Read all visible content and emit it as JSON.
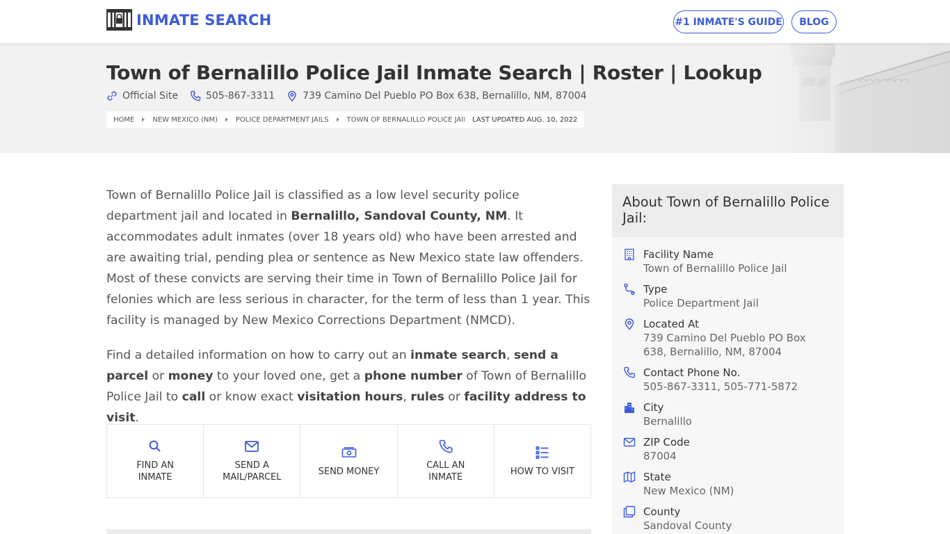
{
  "header": {
    "logo_text": "INMATE SEARCH",
    "nav": [
      {
        "label": "#1 INMATE'S GUIDE"
      },
      {
        "label": "BLOG"
      }
    ]
  },
  "hero": {
    "title": "Town of Bernalillo Police Jail Inmate Search | Roster | Lookup",
    "official_site": "Official Site",
    "phone": "505-867-3311",
    "address": "739 Camino Del Pueblo PO Box 638, Bernalillo, NM, 87004",
    "breadcrumbs": [
      "HOME",
      "NEW MEXICO (NM)",
      "POLICE DEPARTMENT JAILS",
      "TOWN OF BERNALILLO POLICE JAIL"
    ],
    "last_updated": "LAST UPDATED AUG. 10, 2022"
  },
  "content": {
    "p1_a": "Town of Bernalillo Police Jail is classified as a low level security police department jail and located in ",
    "p1_b": "Bernalillo, Sandoval County, NM",
    "p1_c": ". It accommodates adult inmates (over 18 years old) who have been arrested and are awaiting trial, pending plea or sentence as New Mexico state law offenders. Most of these convicts are serving their time in Town of Bernalillo Police Jail for felonies which are less serious in character, for the term of less than 1 year. This facility is managed by New Mexico Corrections Department (NMCD).",
    "p2": [
      {
        "t": "Find a detailed information on how to carry out an ",
        "b": false
      },
      {
        "t": "inmate search",
        "b": true
      },
      {
        "t": ", ",
        "b": false
      },
      {
        "t": "send a parcel",
        "b": true
      },
      {
        "t": " or ",
        "b": false
      },
      {
        "t": "money",
        "b": true
      },
      {
        "t": " to your loved one, get a ",
        "b": false
      },
      {
        "t": "phone number",
        "b": true
      },
      {
        "t": " of Town of Bernalillo Police Jail to ",
        "b": false
      },
      {
        "t": "call",
        "b": true
      },
      {
        "t": " or know exact ",
        "b": false
      },
      {
        "t": "visitation hours",
        "b": true
      },
      {
        "t": ", ",
        "b": false
      },
      {
        "t": "rules",
        "b": true
      },
      {
        "t": " or ",
        "b": false
      },
      {
        "t": "facility address to visit",
        "b": true
      },
      {
        "t": ".",
        "b": false
      }
    ]
  },
  "actions": [
    {
      "line1": "FIND AN",
      "line2": "INMATE",
      "icon": "search-icon"
    },
    {
      "line1": "SEND A",
      "line2": "MAIL/PARCEL",
      "icon": "mail-icon"
    },
    {
      "line1": "SEND MONEY",
      "line2": "",
      "icon": "money-icon"
    },
    {
      "line1": "CALL AN",
      "line2": "INMATE",
      "icon": "phone-icon"
    },
    {
      "line1": "HOW TO VISIT",
      "line2": "",
      "icon": "list-icon"
    }
  ],
  "sidebar": {
    "title": "About Town of Bernalillo Police Jail:",
    "items": [
      {
        "label": "Facility Name",
        "value": "Town of Bernalillo Police Jail",
        "icon": "building-icon"
      },
      {
        "label": "Type",
        "value": "Police Department Jail",
        "icon": "route-icon"
      },
      {
        "label": "Located At",
        "value": "739 Camino Del Pueblo PO Box 638, Bernalillo, NM, 87004",
        "icon": "map-pin-icon"
      },
      {
        "label": "Contact Phone No.",
        "value": "505-867-3311, 505-771-5872",
        "icon": "phone-icon"
      },
      {
        "label": "City",
        "value": "Bernalillo",
        "icon": "city-icon"
      },
      {
        "label": "ZIP Code",
        "value": "87004",
        "icon": "mail-icon"
      },
      {
        "label": "State",
        "value": "New Mexico (NM)",
        "icon": "map-icon"
      },
      {
        "label": "County",
        "value": "Sandoval County",
        "icon": "copy-icon"
      }
    ]
  },
  "colors": {
    "accent": "#3d5bd9",
    "hero_bg": "#f2f2f2",
    "text": "#555555"
  }
}
